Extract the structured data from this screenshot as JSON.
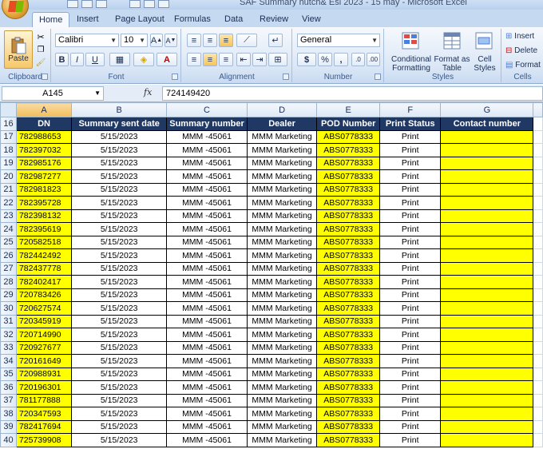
{
  "window": {
    "title": "SAF Summary  hutch& Esl 2023 - 15 may - Microsoft Excel"
  },
  "ribbon": {
    "tabs": [
      "Home",
      "Insert",
      "Page Layout",
      "Formulas",
      "Data",
      "Review",
      "View"
    ],
    "active_tab": "Home",
    "clipboard": {
      "paste_label": "Paste",
      "group_label": "Clipboard"
    },
    "font": {
      "name": "Calibri",
      "size": "10",
      "group_label": "Font",
      "bold": "B",
      "italic": "I",
      "underline": "U"
    },
    "alignment": {
      "group_label": "Alignment"
    },
    "number": {
      "format": "General",
      "group_label": "Number",
      "currency": "$",
      "percent": "%",
      "comma": ","
    },
    "styles": {
      "conditional_formatting": "Conditional Formatting",
      "format_as_table": "Format as Table",
      "cell_styles": "Cell Styles",
      "group_label": "Styles"
    },
    "cells": {
      "insert": "Insert",
      "delete": "Delete",
      "format": "Format",
      "group_label": "Cells"
    }
  },
  "formula_bar": {
    "name_box": "A145",
    "fx": "fx",
    "value": "724149420"
  },
  "sheet": {
    "columns": [
      "A",
      "B",
      "C",
      "D",
      "E",
      "F",
      "G"
    ],
    "selected_column": "A",
    "header_row_number": "16",
    "headers": [
      "DN",
      "Summary sent date",
      "Summary number",
      "Dealer",
      "POD Number",
      "Print Status",
      "Contact number"
    ],
    "rows": [
      {
        "n": "17",
        "dn": "782988653",
        "date": "5/15/2023",
        "summary": "MMM -45061",
        "dealer": "MMM Marketing",
        "pod": "ABS0778333",
        "status": "Print",
        "contact": ""
      },
      {
        "n": "18",
        "dn": "782397032",
        "date": "5/15/2023",
        "summary": "MMM -45061",
        "dealer": "MMM Marketing",
        "pod": "ABS0778333",
        "status": "Print",
        "contact": ""
      },
      {
        "n": "19",
        "dn": "782985176",
        "date": "5/15/2023",
        "summary": "MMM -45061",
        "dealer": "MMM Marketing",
        "pod": "ABS0778333",
        "status": "Print",
        "contact": ""
      },
      {
        "n": "20",
        "dn": "782987277",
        "date": "5/15/2023",
        "summary": "MMM -45061",
        "dealer": "MMM Marketing",
        "pod": "ABS0778333",
        "status": "Print",
        "contact": ""
      },
      {
        "n": "21",
        "dn": "782981823",
        "date": "5/15/2023",
        "summary": "MMM -45061",
        "dealer": "MMM Marketing",
        "pod": "ABS0778333",
        "status": "Print",
        "contact": ""
      },
      {
        "n": "22",
        "dn": "782395728",
        "date": "5/15/2023",
        "summary": "MMM -45061",
        "dealer": "MMM Marketing",
        "pod": "ABS0778333",
        "status": "Print",
        "contact": ""
      },
      {
        "n": "23",
        "dn": "782398132",
        "date": "5/15/2023",
        "summary": "MMM -45061",
        "dealer": "MMM Marketing",
        "pod": "ABS0778333",
        "status": "Print",
        "contact": ""
      },
      {
        "n": "24",
        "dn": "782395619",
        "date": "5/15/2023",
        "summary": "MMM -45061",
        "dealer": "MMM Marketing",
        "pod": "ABS0778333",
        "status": "Print",
        "contact": ""
      },
      {
        "n": "25",
        "dn": "720582518",
        "date": "5/15/2023",
        "summary": "MMM -45061",
        "dealer": "MMM Marketing",
        "pod": "ABS0778333",
        "status": "Print",
        "contact": ""
      },
      {
        "n": "26",
        "dn": "782442492",
        "date": "5/15/2023",
        "summary": "MMM -45061",
        "dealer": "MMM Marketing",
        "pod": "ABS0778333",
        "status": "Print",
        "contact": ""
      },
      {
        "n": "27",
        "dn": "782437778",
        "date": "5/15/2023",
        "summary": "MMM -45061",
        "dealer": "MMM Marketing",
        "pod": "ABS0778333",
        "status": "Print",
        "contact": ""
      },
      {
        "n": "28",
        "dn": "782402417",
        "date": "5/15/2023",
        "summary": "MMM -45061",
        "dealer": "MMM Marketing",
        "pod": "ABS0778333",
        "status": "Print",
        "contact": ""
      },
      {
        "n": "29",
        "dn": "720783426",
        "date": "5/15/2023",
        "summary": "MMM -45061",
        "dealer": "MMM Marketing",
        "pod": "ABS0778333",
        "status": "Print",
        "contact": ""
      },
      {
        "n": "30",
        "dn": "720627574",
        "date": "5/15/2023",
        "summary": "MMM -45061",
        "dealer": "MMM Marketing",
        "pod": "ABS0778333",
        "status": "Print",
        "contact": ""
      },
      {
        "n": "31",
        "dn": "720345919",
        "date": "5/15/2023",
        "summary": "MMM -45061",
        "dealer": "MMM Marketing",
        "pod": "ABS0778333",
        "status": "Print",
        "contact": ""
      },
      {
        "n": "32",
        "dn": "720714990",
        "date": "5/15/2023",
        "summary": "MMM -45061",
        "dealer": "MMM Marketing",
        "pod": "ABS0778333",
        "status": "Print",
        "contact": ""
      },
      {
        "n": "33",
        "dn": "720927677",
        "date": "5/15/2023",
        "summary": "MMM -45061",
        "dealer": "MMM Marketing",
        "pod": "ABS0778333",
        "status": "Print",
        "contact": ""
      },
      {
        "n": "34",
        "dn": "720161649",
        "date": "5/15/2023",
        "summary": "MMM -45061",
        "dealer": "MMM Marketing",
        "pod": "ABS0778333",
        "status": "Print",
        "contact": ""
      },
      {
        "n": "35",
        "dn": "720988931",
        "date": "5/15/2023",
        "summary": "MMM -45061",
        "dealer": "MMM Marketing",
        "pod": "ABS0778333",
        "status": "Print",
        "contact": ""
      },
      {
        "n": "36",
        "dn": "720196301",
        "date": "5/15/2023",
        "summary": "MMM -45061",
        "dealer": "MMM Marketing",
        "pod": "ABS0778333",
        "status": "Print",
        "contact": ""
      },
      {
        "n": "37",
        "dn": "781177888",
        "date": "5/15/2023",
        "summary": "MMM -45061",
        "dealer": "MMM Marketing",
        "pod": "ABS0778333",
        "status": "Print",
        "contact": ""
      },
      {
        "n": "38",
        "dn": "720347593",
        "date": "5/15/2023",
        "summary": "MMM -45061",
        "dealer": "MMM Marketing",
        "pod": "ABS0778333",
        "status": "Print",
        "contact": ""
      },
      {
        "n": "39",
        "dn": "782417694",
        "date": "5/15/2023",
        "summary": "MMM -45061",
        "dealer": "MMM Marketing",
        "pod": "ABS0778333",
        "status": "Print",
        "contact": ""
      },
      {
        "n": "40",
        "dn": "725739908",
        "date": "5/15/2023",
        "summary": "MMM -45061",
        "dealer": "MMM Marketing",
        "pod": "ABS0778333",
        "status": "Print",
        "contact": ""
      }
    ]
  },
  "colors": {
    "header_fill": "#1f3864",
    "highlight": "#ffff00",
    "ribbon": "#dbe7f6"
  }
}
